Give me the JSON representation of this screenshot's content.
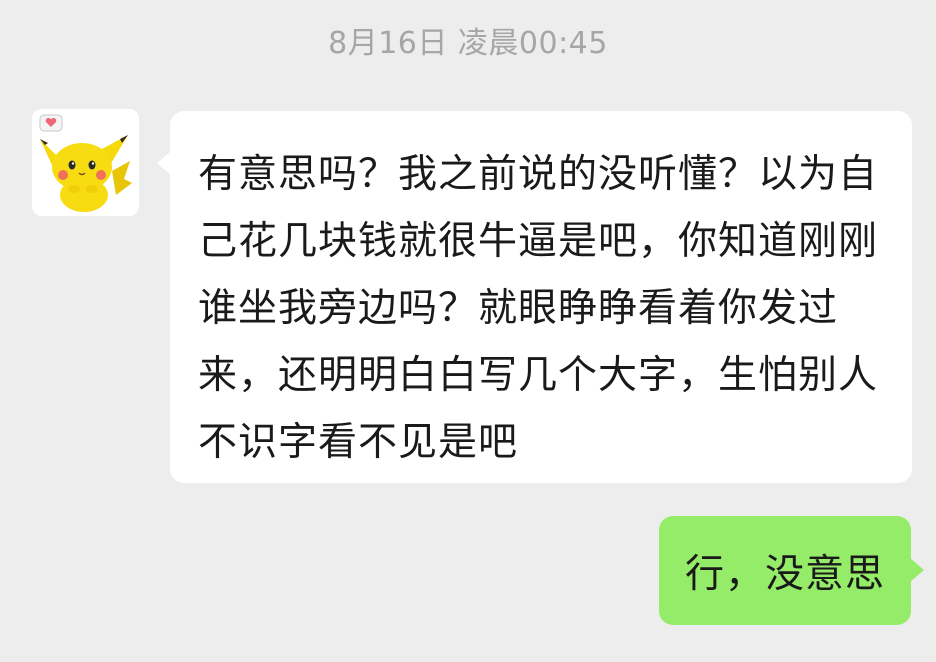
{
  "timestamp": "8月16日 凌晨00:45",
  "messages": [
    {
      "side": "incoming",
      "avatar": "pikachu-avatar-icon",
      "text": "有意思吗？我之前说的没听懂？以为自己花几块钱就很牛逼是吧，你知道刚刚谁坐我旁边吗？就眼睁睁看着你发过来，还明明白白写几个大字，生怕别人不识字看不见是吧"
    },
    {
      "side": "outgoing",
      "text": "行，没意思"
    }
  ],
  "colors": {
    "background": "#ededed",
    "incoming_bubble": "#ffffff",
    "outgoing_bubble": "#95ec69",
    "timestamp": "#a6a6a6"
  }
}
